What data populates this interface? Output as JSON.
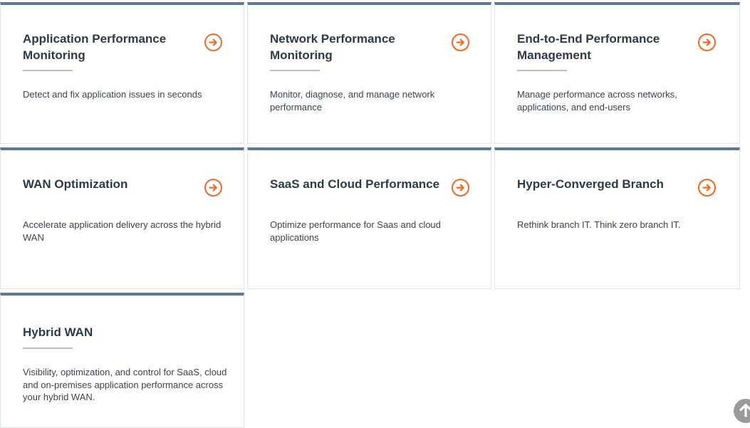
{
  "colors": {
    "accent": "#ef6a25",
    "card_top_border": "#5e7a91",
    "title_text": "#2e3b47",
    "body_text": "#3b4450"
  },
  "cards": [
    {
      "title": "Application Performance Monitoring",
      "description": "Detect and fix application issues in seconds",
      "icon": "arrow-right-circle-icon"
    },
    {
      "title": "Network Performance Monitoring",
      "description": "Monitor, diagnose, and manage network performance",
      "icon": "arrow-right-circle-icon"
    },
    {
      "title": "End-to-End Performance Management",
      "description": "Manage performance across networks, applications, and end-users",
      "icon": "arrow-right-circle-icon"
    },
    {
      "title": "WAN Optimization",
      "description": "Accelerate application delivery across the hybrid WAN",
      "icon": "arrow-right-circle-icon"
    },
    {
      "title": "SaaS and Cloud Performance",
      "description": "Optimize performance for Saas and cloud applications",
      "icon": "arrow-right-circle-icon"
    },
    {
      "title": "Hyper-Converged Branch",
      "description": "Rethink branch IT. Think zero branch IT.",
      "icon": "arrow-right-circle-icon"
    },
    {
      "title": "Hybrid WAN",
      "description": "Visibility, optimization, and control for SaaS, cloud and on-premises application performance across your hybrid WAN."
    }
  ],
  "scroll_top": {
    "icon": "arrow-up-icon"
  }
}
